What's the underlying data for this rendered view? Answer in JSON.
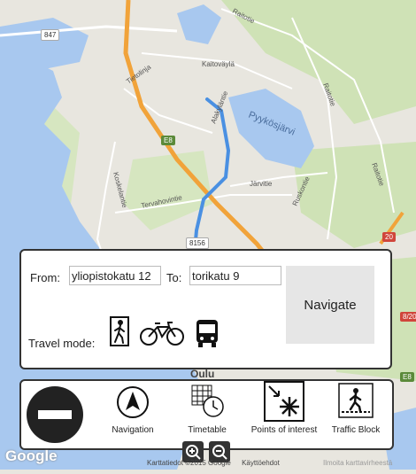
{
  "map": {
    "labels": [
      "Raitotie",
      "Kaitoväylä",
      "Tietolinja",
      "Alakyläntie",
      "Pyykösjärvi",
      "Koskelantie",
      "Tervahovintie",
      "Järvitie",
      "Ruskontie",
      "Raitotie",
      "Raitotie",
      "Oulu"
    ],
    "shields": [
      "847",
      "E8",
      "8156",
      "20",
      "8/20",
      "E8"
    ],
    "google_logo": "Google",
    "copyright": "Karttatiedot ©2015 Google",
    "terms": "Käyttöehdot",
    "report": "Ilmoita karttavirheestä"
  },
  "route": {
    "from_label": "From:",
    "from_value": "yliopistokatu 12",
    "to_label": "To:",
    "to_value": "torikatu 9",
    "navigate_label": "Navigate",
    "travel_mode_label": "Travel mode:",
    "modes": [
      "walk-icon",
      "bicycle-icon",
      "bus-icon"
    ]
  },
  "toolbar": {
    "items": [
      {
        "label": "Navigation",
        "icon": "navigation-arrow-icon"
      },
      {
        "label": "Timetable",
        "icon": "timetable-icon"
      },
      {
        "label": "Points of interest",
        "icon": "points-of-interest-icon"
      },
      {
        "label": "Traffic Block",
        "icon": "traffic-block-icon"
      }
    ]
  },
  "colors": {
    "water": "#a8c8ef",
    "road_main": "#f1a33a",
    "route": "#4a90e2",
    "land": "#e8e6df",
    "park": "#c9dfb0"
  }
}
